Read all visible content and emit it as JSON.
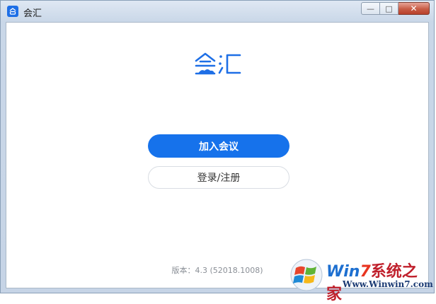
{
  "window": {
    "title": "会汇",
    "controls": {
      "minimize": "—",
      "maximize": "□",
      "close": "✕"
    }
  },
  "app": {
    "logo_text": "会汇",
    "join_button": "加入会议",
    "login_button": "登录/注册",
    "version": "版本：4.3 (52018.1008)"
  },
  "watermark": {
    "line1_win": "Win",
    "line1_seven": "7",
    "line1_cn": "系统之家",
    "line2": "Www.Winwin7.com"
  },
  "colors": {
    "accent": "#1672eb",
    "logo_blue": "#1e6fe6"
  }
}
